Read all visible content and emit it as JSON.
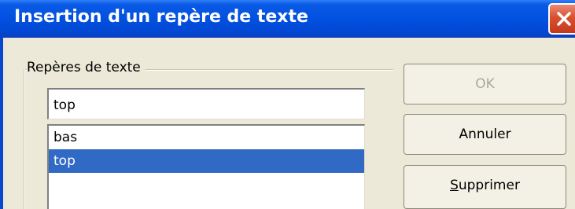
{
  "window": {
    "title": "Insertion d'un repère de texte",
    "close_icon": "close-icon"
  },
  "group": {
    "label": "Repères de texte"
  },
  "name_input": {
    "value": "top"
  },
  "bookmark_list": {
    "items": [
      {
        "label": "bas",
        "selected": false
      },
      {
        "label": "top",
        "selected": true
      }
    ]
  },
  "buttons": {
    "ok_label": "OK",
    "cancel_label": "Annuler",
    "delete_label_mnemonic": "S",
    "delete_label_rest": "upprimer"
  },
  "colors": {
    "titlebar": "#0250e0",
    "selection": "#316ac5",
    "close_button": "#d9502f",
    "dialog_bg": "#ece9d8"
  }
}
